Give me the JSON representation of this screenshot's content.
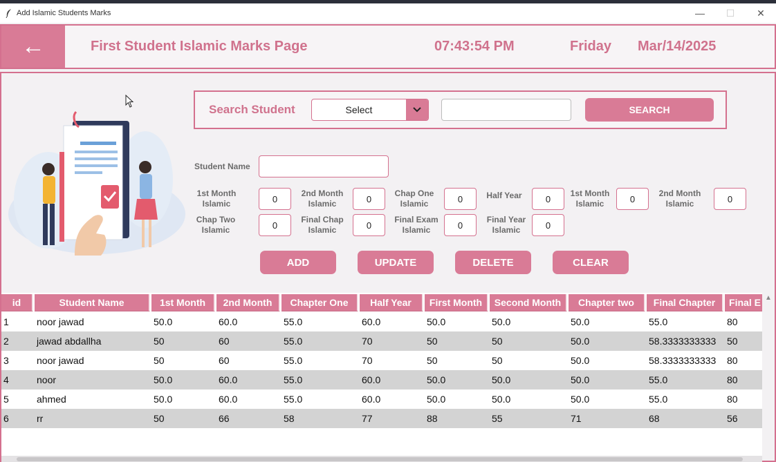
{
  "window": {
    "title": "Add Islamic Students Marks",
    "controls": [
      "—",
      "☐",
      "✕"
    ]
  },
  "header": {
    "back_label": "←",
    "page_title": "First Student Islamic Marks Page",
    "time": "07:43:54 PM",
    "day": "Friday",
    "date": "Mar/14/2025"
  },
  "search": {
    "label": "Search Student",
    "select_value": "Select",
    "arrow": "⌄",
    "input_value": "",
    "button_label": "SEARCH"
  },
  "form": {
    "student_name_label": "Student Name",
    "student_name_value": "",
    "fields": [
      {
        "label1": "1st Month",
        "label2": "Islamic",
        "value": "0"
      },
      {
        "label1": "2nd Month",
        "label2": "Islamic",
        "value": "0"
      },
      {
        "label1": "Chap One",
        "label2": "Islamic",
        "value": "0"
      },
      {
        "label1": "Half Year",
        "label2": "",
        "value": "0"
      },
      {
        "label1": "1st Month",
        "label2": "Islamic",
        "value": "0"
      },
      {
        "label1": "2nd Month",
        "label2": "Islamic",
        "value": "0"
      },
      {
        "label1": "Chap Two",
        "label2": "Islamic",
        "value": "0"
      },
      {
        "label1": "Final Chap",
        "label2": "Islamic",
        "value": "0"
      },
      {
        "label1": "Final Exam",
        "label2": "Islamic",
        "value": "0"
      },
      {
        "label1": "Final Year",
        "label2": "Islamic",
        "value": "0"
      }
    ]
  },
  "actions": {
    "add": "ADD",
    "update": "UPDATE",
    "delete": "DELETE",
    "clear": "CLEAR"
  },
  "table": {
    "columns": [
      "id",
      "Student Name",
      "1st Month",
      "2nd Month",
      "Chapter One",
      "Half Year",
      "First Month",
      "Second Month",
      "Chapter two",
      "Final Chapter",
      "Final E"
    ],
    "rows": [
      [
        "1",
        "noor jawad",
        "50.0",
        "60.0",
        "55.0",
        "60.0",
        "50.0",
        "50.0",
        "50.0",
        "55.0",
        "80"
      ],
      [
        "2",
        "jawad abdallha",
        "50",
        "60",
        "55.0",
        "70",
        "50",
        "50",
        "50.0",
        "58.3333333333",
        "50"
      ],
      [
        "3",
        "noor jawad",
        "50",
        "60",
        "55.0",
        "70",
        "50",
        "50",
        "50.0",
        "58.3333333333",
        "80"
      ],
      [
        "4",
        "noor",
        "50.0",
        "60.0",
        "55.0",
        "60.0",
        "50.0",
        "50.0",
        "50.0",
        "55.0",
        "80"
      ],
      [
        "5",
        "ahmed",
        "50.0",
        "60.0",
        "55.0",
        "60.0",
        "50.0",
        "50.0",
        "50.0",
        "55.0",
        "80"
      ],
      [
        "6",
        "rr",
        "50",
        "66",
        "58",
        "77",
        "88",
        "55",
        "71",
        "68",
        "56"
      ]
    ]
  },
  "colors": {
    "accent": "#d97b96",
    "accent_text": "#d0728d",
    "row_alt": "#d3d3d3"
  }
}
